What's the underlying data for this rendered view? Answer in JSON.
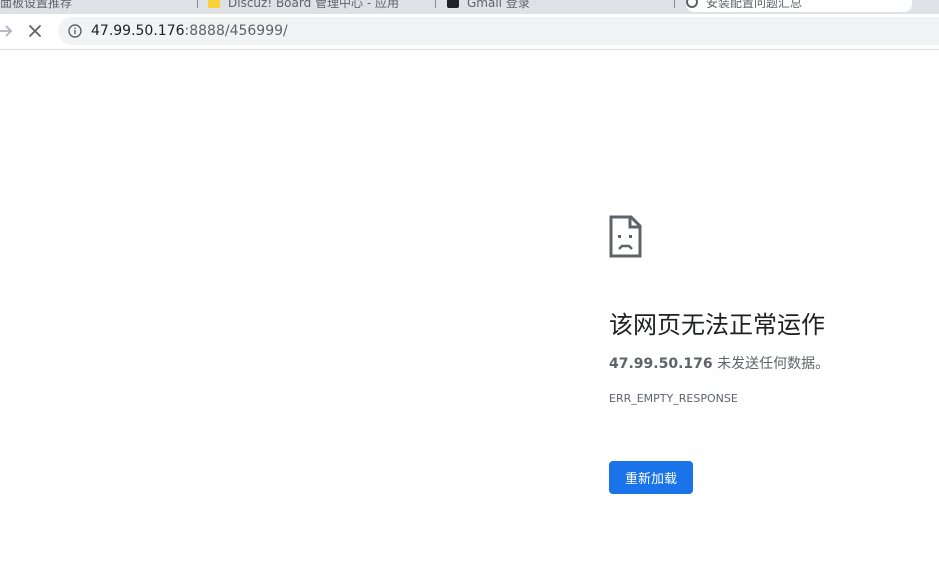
{
  "tabs": [
    {
      "title": "面板设置推荐",
      "favicon": "none"
    },
    {
      "title": "Discuz! Board 管理中心 - 应用",
      "favicon": "document-icon"
    },
    {
      "title": "Gmail 登录",
      "favicon": "black-square-icon"
    },
    {
      "title": "安装配置问题汇总",
      "favicon": "loading-circle-icon"
    }
  ],
  "toolbar": {
    "back_icon": "arrow-right-icon",
    "stop_icon": "close-icon",
    "url_host": "47.99.50.176",
    "url_rest": ":8888/456999/"
  },
  "error": {
    "icon": "sad-page-icon",
    "title": "该网页无法正常运作",
    "host": "47.99.50.176",
    "message": " 未发送任何数据。",
    "code": "ERR_EMPTY_RESPONSE",
    "reload_label": "重新加载"
  },
  "colors": {
    "accent": "#1a73e8",
    "omnibox_bg": "#f1f3f4",
    "tabstrip_bg": "#dee1e6",
    "text_primary": "#202124",
    "text_secondary": "#5f6368"
  }
}
